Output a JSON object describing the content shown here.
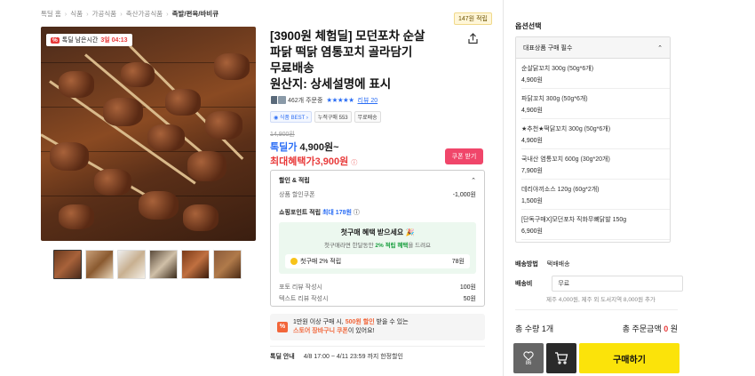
{
  "breadcrumb": [
    "톡딜 홈",
    "식품",
    "가공식품",
    "축산가공식품",
    "족발/편육/바비큐"
  ],
  "points_badge": "147원 적립",
  "sale_badge": {
    "pct": "%",
    "label": "톡딜 남은시간",
    "time": "3일 04:13"
  },
  "title_lines": [
    "[3900원 체험딜] 모던포차 순살",
    "파닭 떡닭 염통꼬치 골라담기",
    "무료배송",
    "원산지: 상세설명에 표시"
  ],
  "rating": {
    "orders": "462개 주문중",
    "stars": "★★★★★",
    "review": "리뷰 20"
  },
  "tags": [
    "식품 BEST",
    "누적구매 553",
    "무료배송"
  ],
  "price": {
    "original": "14,900원",
    "deal_label": "톡딜가",
    "deal_value": "4,900원~",
    "max_label": "최대혜택가",
    "max_value": "3,900원",
    "coupon_btn": "쿠폰 받기"
  },
  "benefits": {
    "header": "할인 & 적립",
    "coupon_label": "상품 할인쿠폰",
    "coupon_value": "-1,000원",
    "point_label": "쇼핑포인트 적립",
    "point_max": "최대 178원",
    "first_title": "첫구매 혜택 받으세요 🎉",
    "first_sub_pre": "첫구매라면 한달동안 ",
    "first_sub_bold": "2% 적립 혜택",
    "first_sub_post": "을 드려요",
    "first_row_label": "첫구매 2% 적립",
    "first_row_value": "78원",
    "photo_label": "포토 리뷰 작성시",
    "photo_value": "100원",
    "text_label": "텍스트 리뷰 작성시",
    "text_value": "50원"
  },
  "event": {
    "line1_pre": "1만원 이상 구매 시, ",
    "line1_hl": "500원 할인",
    "line1_post": " 받을 수 있는",
    "line2_hl": "스토어 장바구니 쿠폰",
    "line2_post": "이 있어요!"
  },
  "deal_info": {
    "label": "톡딜 안내",
    "value": "4/8 17:00 ~ 4/11 23:59 까지 한정할인"
  },
  "options": {
    "title": "옵션선택",
    "header": "대표상품 구매 필수",
    "items": [
      {
        "name": "순살닭꼬치 300g (50g*6개)",
        "price": "4,900원"
      },
      {
        "name": "파닭꼬치 300g (50g*6개)",
        "price": "4,900원"
      },
      {
        "name": "★추천★떡닭꼬치 300g (50g*6개)",
        "price": "4,900원"
      },
      {
        "name": "국내산 염통꼬치 600g (30g*20개)",
        "price": "7,900원"
      },
      {
        "name": "데리야끼소스 120g (60g*2개)",
        "price": "1,500원"
      },
      {
        "name": "[단독구매X]모던포차 직화무뼈닭발 150g",
        "price": "6,900원"
      }
    ]
  },
  "shipping": {
    "method_label": "배송방법",
    "method_value": "택배배송",
    "fee_label": "배송비",
    "fee_value": "무료",
    "fee_note": "제주 4,000원, 제주 외 도서지역 8,000원 추가"
  },
  "totals": {
    "qty_label": "총 수량",
    "qty_value": "1개",
    "amount_label": "총 주문금액",
    "amount_value": "0",
    "amount_unit": "원"
  },
  "buttons": {
    "likes": "86",
    "buy": "구매하기"
  },
  "colors": {
    "accent_blue": "#2b6ef5",
    "accent_red": "#e83a3a",
    "buy_yellow": "#fbe30a",
    "coupon_pink": "#f0466a"
  }
}
